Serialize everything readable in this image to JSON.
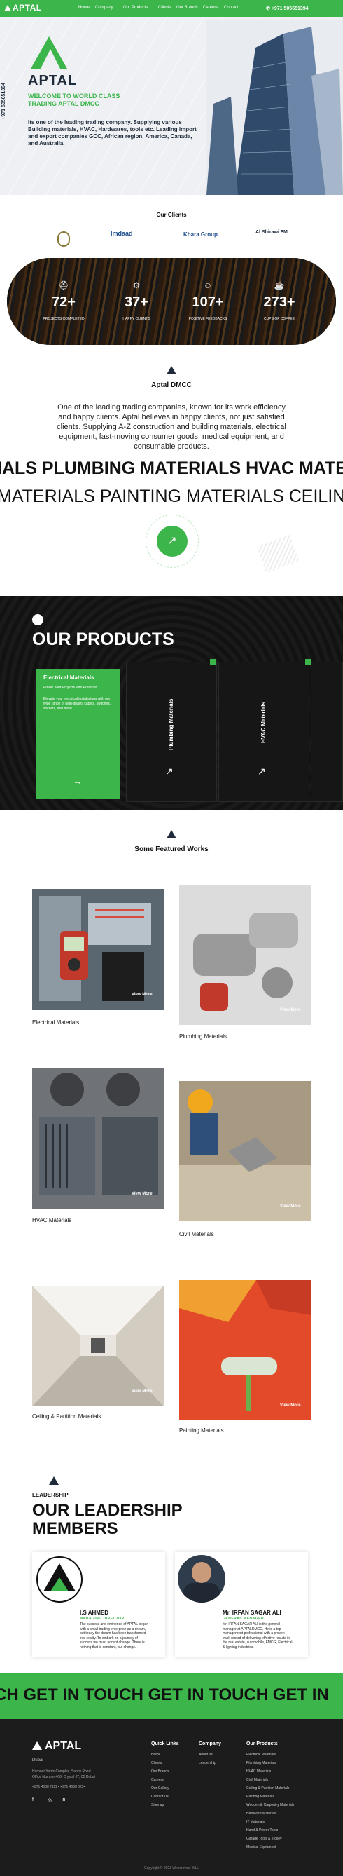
{
  "header": {
    "brand": "APTAL",
    "nav": [
      "Home",
      "Company",
      "Our Products",
      "Clients",
      "Our Brands",
      "Careers",
      "Contact"
    ],
    "phone": "+971 505651394"
  },
  "hero": {
    "brand": "APTAL",
    "headline": "WELCOME TO WORLD CLASS TRADING APTAL DMCC",
    "text": "Its one of the leading trading company. Supplying various Building materials, HVAC, Hardwares, tools etc. Leading import and export companies GCC, African region, America, Canada, and Australia.",
    "side_phone": "+971 505651394"
  },
  "clients": {
    "title": "Our Clients",
    "logos": [
      "Imdaad",
      "Khara Group",
      "Al Shirawi FM"
    ]
  },
  "stats": [
    {
      "value": "72+",
      "label": "PROJECTS COMPLETED",
      "icon": "helmet-icon"
    },
    {
      "value": "37+",
      "label": "HAPPY CLIENTS",
      "icon": "gear-icon"
    },
    {
      "value": "107+",
      "label": "POSITIVE FEEDBACKS",
      "icon": "feedback-icon"
    },
    {
      "value": "273+",
      "label": "CUPS OF COFFEE",
      "icon": "coffee-icon"
    }
  ],
  "about": {
    "title": "Aptal DMCC",
    "text": "One of the leading trading companies, known for its work efficiency and happy clients. Aptal believes in happy clients, not just satisfied clients. Supplying A-Z construction and building materials, electrical equipment, fast-moving consumer goods, medical equipment, and consumable products."
  },
  "marquee": {
    "line1": "IALS  PLUMBING MATERIALS  HVAC MATE",
    "line2": "MATERIALS  PAINTING MATERIALS  CEILIN"
  },
  "products": {
    "title": "OUR PRODUCTS",
    "featured": {
      "title": "Electrical Materials",
      "subtitle": "Power Your Projects with Precision",
      "text": "Elevate your electrical installations with our wide range of high-quality cables, switches, sockets, and more."
    },
    "cards": [
      "Plumbing Materials",
      "HVAC Materials"
    ]
  },
  "works": {
    "title": "Some Featured Works",
    "view_more": "View More",
    "items": [
      "Electrical Materials",
      "Plumbing Materials",
      "HVAC Materials",
      "Civil Materials",
      "Ceiling & Partition Materials",
      "Painting Materials"
    ]
  },
  "leadership": {
    "sup": "LEADERSHIP",
    "title": "OUR LEADERSHIP MEMBERS",
    "members": [
      {
        "name": "I.S AHMED",
        "role": "MANAGING DIRECTOR",
        "text": "The success and eminence of APTAL began with a small trading enterprise as a dream, but today the dream has been transformed into reality. To embark on a journey of success we must accept change. There is nothing that is constant, but change."
      },
      {
        "name": "Mr. IRFAN SAGAR ALI",
        "role": "GENERAL MANAGER",
        "text": "Mr. IRFAN SAGAR ALI is the general manager at APTALDMCC. He is a top management professional with a proven track record of delivering effective results in the real estate, automobile, FMCG, Electrical & lighting industries."
      }
    ]
  },
  "touch": {
    "text": "CH GET IN TOUCH GET IN TOUCH GET IN"
  },
  "footer": {
    "brand": "APTAL",
    "city": "Dubai",
    "address_line1": "Harbour Yards Complex, Sanny Road",
    "address_line2": "Office Number 406, Crystal 07, 05 Dubai",
    "phones": "+971 4568 7111 • +971 4568 0234",
    "quick_links_title": "Quick Links",
    "quick_links": [
      "Home",
      "Clients",
      "Our Brands",
      "Careers",
      "Our Gallery",
      "Contact Us",
      "Sitemap"
    ],
    "company_title": "Company",
    "company_links": [
      "About us",
      "Leadership"
    ],
    "products_title": "Our Products",
    "products_links": [
      "Electrical Materials",
      "Plumbing Materials",
      "HVAC Materials",
      "Civil Materials",
      "Ceiling & Partition Materials",
      "Painting Materials",
      "Wooden & Carpentry Materials",
      "Hardware Materials",
      "IT Materials",
      "Hand & Power Tools",
      "Garage Tools & Trolley",
      "Medical Equipment"
    ],
    "copyright": "Copyright © 2023 Webcrowns WLL"
  },
  "colors": {
    "brand_green": "#3cb54a",
    "dark": "#111111",
    "footer": "#1c1c1c"
  }
}
